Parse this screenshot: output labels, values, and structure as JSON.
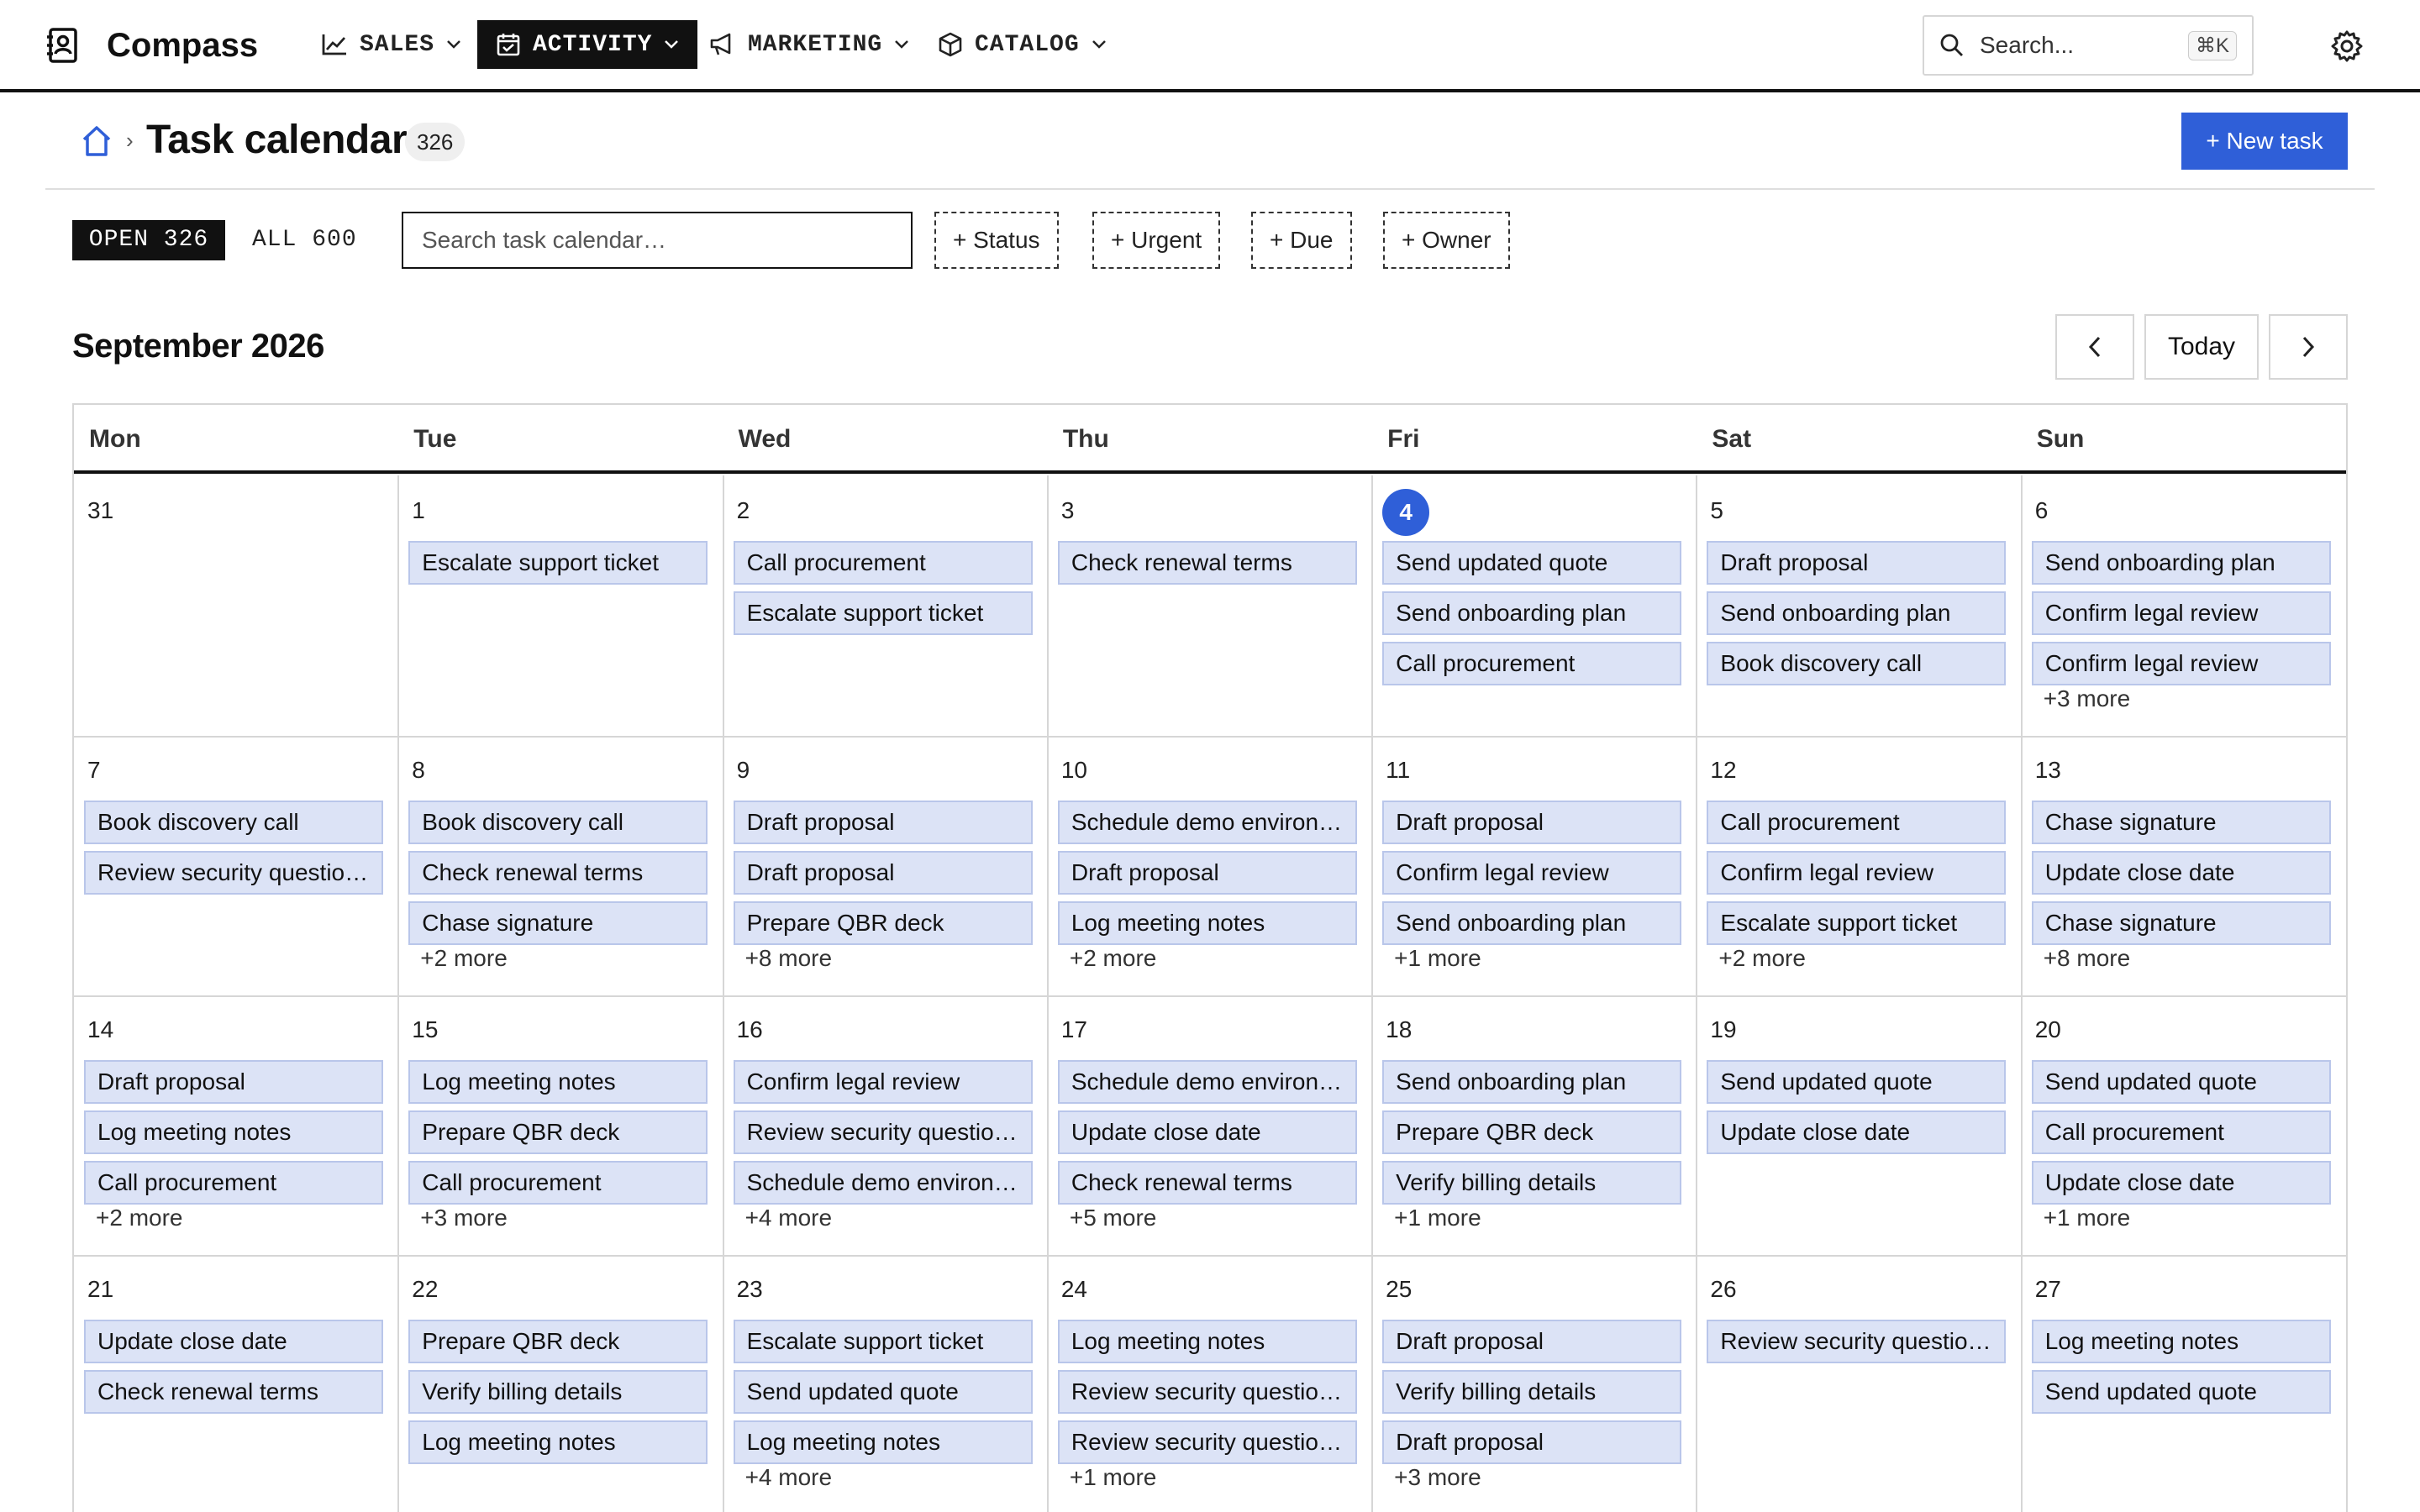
{
  "app": {
    "name": "Compass"
  },
  "nav": [
    {
      "label": "SALES",
      "icon": "chart-line-icon",
      "active": false
    },
    {
      "label": "ACTIVITY",
      "icon": "calendar-check-icon",
      "active": true
    },
    {
      "label": "MARKETING",
      "icon": "megaphone-icon",
      "active": false
    },
    {
      "label": "CATALOG",
      "icon": "box-icon",
      "active": false
    }
  ],
  "search": {
    "placeholder": "Search...",
    "shortcut": "⌘K"
  },
  "header": {
    "title": "Task calendar",
    "count": "326",
    "new_task_label": "+ New task"
  },
  "filters": {
    "segments": {
      "open": "OPEN 326",
      "all": "ALL 600"
    },
    "search_placeholder": "Search task calendar…",
    "chips": [
      "+ Status",
      "+ Urgent",
      "+ Due",
      "+ Owner"
    ]
  },
  "calendar": {
    "month_label": "September 2026",
    "today_label": "Today",
    "weekdays": [
      "Mon",
      "Tue",
      "Wed",
      "Thu",
      "Fri",
      "Sat",
      "Sun"
    ],
    "today_day": "4",
    "weeks": [
      [
        {
          "day": "31",
          "tasks": [],
          "more": ""
        },
        {
          "day": "1",
          "tasks": [
            "Escalate support ticket"
          ],
          "more": ""
        },
        {
          "day": "2",
          "tasks": [
            "Call procurement",
            "Escalate support ticket"
          ],
          "more": ""
        },
        {
          "day": "3",
          "tasks": [
            "Check renewal terms"
          ],
          "more": ""
        },
        {
          "day": "4",
          "tasks": [
            "Send updated quote",
            "Send onboarding plan",
            "Call procurement"
          ],
          "more": ""
        },
        {
          "day": "5",
          "tasks": [
            "Draft proposal",
            "Send onboarding plan",
            "Book discovery call"
          ],
          "more": ""
        },
        {
          "day": "6",
          "tasks": [
            "Send onboarding plan",
            "Confirm legal review",
            "Confirm legal review"
          ],
          "more": "+3 more"
        }
      ],
      [
        {
          "day": "7",
          "tasks": [
            "Book discovery call",
            "Review security questio…"
          ],
          "more": ""
        },
        {
          "day": "8",
          "tasks": [
            "Book discovery call",
            "Check renewal terms",
            "Chase signature"
          ],
          "more": "+2 more"
        },
        {
          "day": "9",
          "tasks": [
            "Draft proposal",
            "Draft proposal",
            "Prepare QBR deck"
          ],
          "more": "+8 more"
        },
        {
          "day": "10",
          "tasks": [
            "Schedule demo environ…",
            "Draft proposal",
            "Log meeting notes"
          ],
          "more": "+2 more"
        },
        {
          "day": "11",
          "tasks": [
            "Draft proposal",
            "Confirm legal review",
            "Send onboarding plan"
          ],
          "more": "+1 more"
        },
        {
          "day": "12",
          "tasks": [
            "Call procurement",
            "Confirm legal review",
            "Escalate support ticket"
          ],
          "more": "+2 more"
        },
        {
          "day": "13",
          "tasks": [
            "Chase signature",
            "Update close date",
            "Chase signature"
          ],
          "more": "+8 more"
        }
      ],
      [
        {
          "day": "14",
          "tasks": [
            "Draft proposal",
            "Log meeting notes",
            "Call procurement"
          ],
          "more": "+2 more"
        },
        {
          "day": "15",
          "tasks": [
            "Log meeting notes",
            "Prepare QBR deck",
            "Call procurement"
          ],
          "more": "+3 more"
        },
        {
          "day": "16",
          "tasks": [
            "Confirm legal review",
            "Review security questio…",
            "Schedule demo environ…"
          ],
          "more": "+4 more"
        },
        {
          "day": "17",
          "tasks": [
            "Schedule demo environ…",
            "Update close date",
            "Check renewal terms"
          ],
          "more": "+5 more"
        },
        {
          "day": "18",
          "tasks": [
            "Send onboarding plan",
            "Prepare QBR deck",
            "Verify billing details"
          ],
          "more": "+1 more"
        },
        {
          "day": "19",
          "tasks": [
            "Send updated quote",
            "Update close date"
          ],
          "more": ""
        },
        {
          "day": "20",
          "tasks": [
            "Send updated quote",
            "Call procurement",
            "Update close date"
          ],
          "more": "+1 more"
        }
      ],
      [
        {
          "day": "21",
          "tasks": [
            "Update close date",
            "Check renewal terms"
          ],
          "more": ""
        },
        {
          "day": "22",
          "tasks": [
            "Prepare QBR deck",
            "Verify billing details",
            "Log meeting notes"
          ],
          "more": ""
        },
        {
          "day": "23",
          "tasks": [
            "Escalate support ticket",
            "Send updated quote",
            "Log meeting notes"
          ],
          "more": "+4 more"
        },
        {
          "day": "24",
          "tasks": [
            "Log meeting notes",
            "Review security questio…",
            "Review security questio…"
          ],
          "more": "+1 more"
        },
        {
          "day": "25",
          "tasks": [
            "Draft proposal",
            "Verify billing details",
            "Draft proposal"
          ],
          "more": "+3 more"
        },
        {
          "day": "26",
          "tasks": [
            "Review security questio…"
          ],
          "more": ""
        },
        {
          "day": "27",
          "tasks": [
            "Log meeting notes",
            "Send updated quote"
          ],
          "more": ""
        }
      ]
    ]
  },
  "colors": {
    "accent": "#2f5fd8",
    "task_bg": "#dce3f6",
    "task_border": "#b9c6ea",
    "ink": "#111111"
  }
}
